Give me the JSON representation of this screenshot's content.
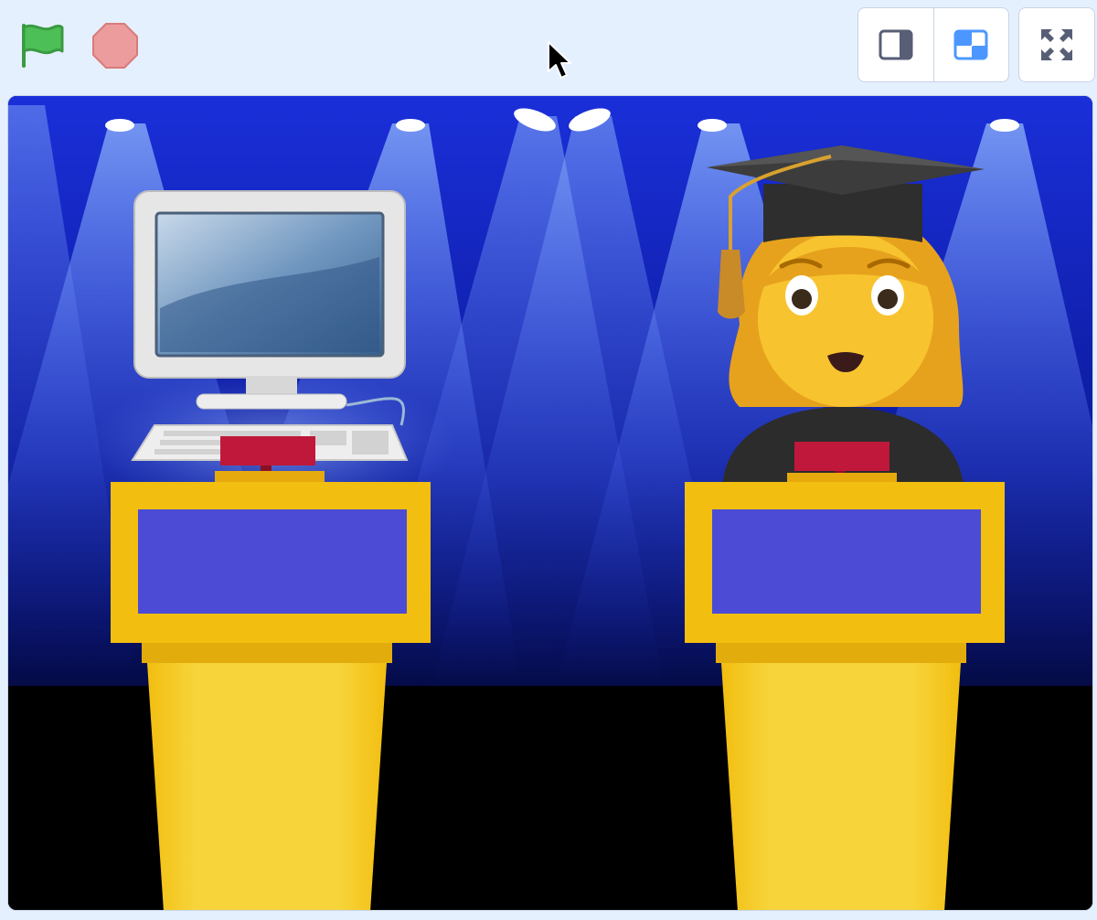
{
  "toolbar": {
    "green_flag": {
      "icon": "green-flag-icon",
      "color": "#4cbf56"
    },
    "stop": {
      "icon": "stop-sign-icon",
      "color": "#ec9c9c"
    },
    "layout_small_stage": {
      "icon": "small-stage-icon",
      "color": "#575e75"
    },
    "layout_normal_stage": {
      "icon": "normal-stage-icon",
      "color": "#4c97ff",
      "selected": true
    },
    "fullscreen": {
      "icon": "fullscreen-icon",
      "color": "#575e75"
    }
  },
  "stage": {
    "backdrop": {
      "name": "spotlight-stage",
      "top_color": "#1a2fd9",
      "floor_color": "#000000"
    },
    "sprites": [
      {
        "name": "computer",
        "icon": "desktop-computer-icon"
      },
      {
        "name": "graduate",
        "icon": "woman-student-icon"
      }
    ],
    "podium": {
      "frame_color": "#f2be10",
      "panel_color": "#4c4bd6",
      "buzzer_color": "#c0183a"
    }
  }
}
